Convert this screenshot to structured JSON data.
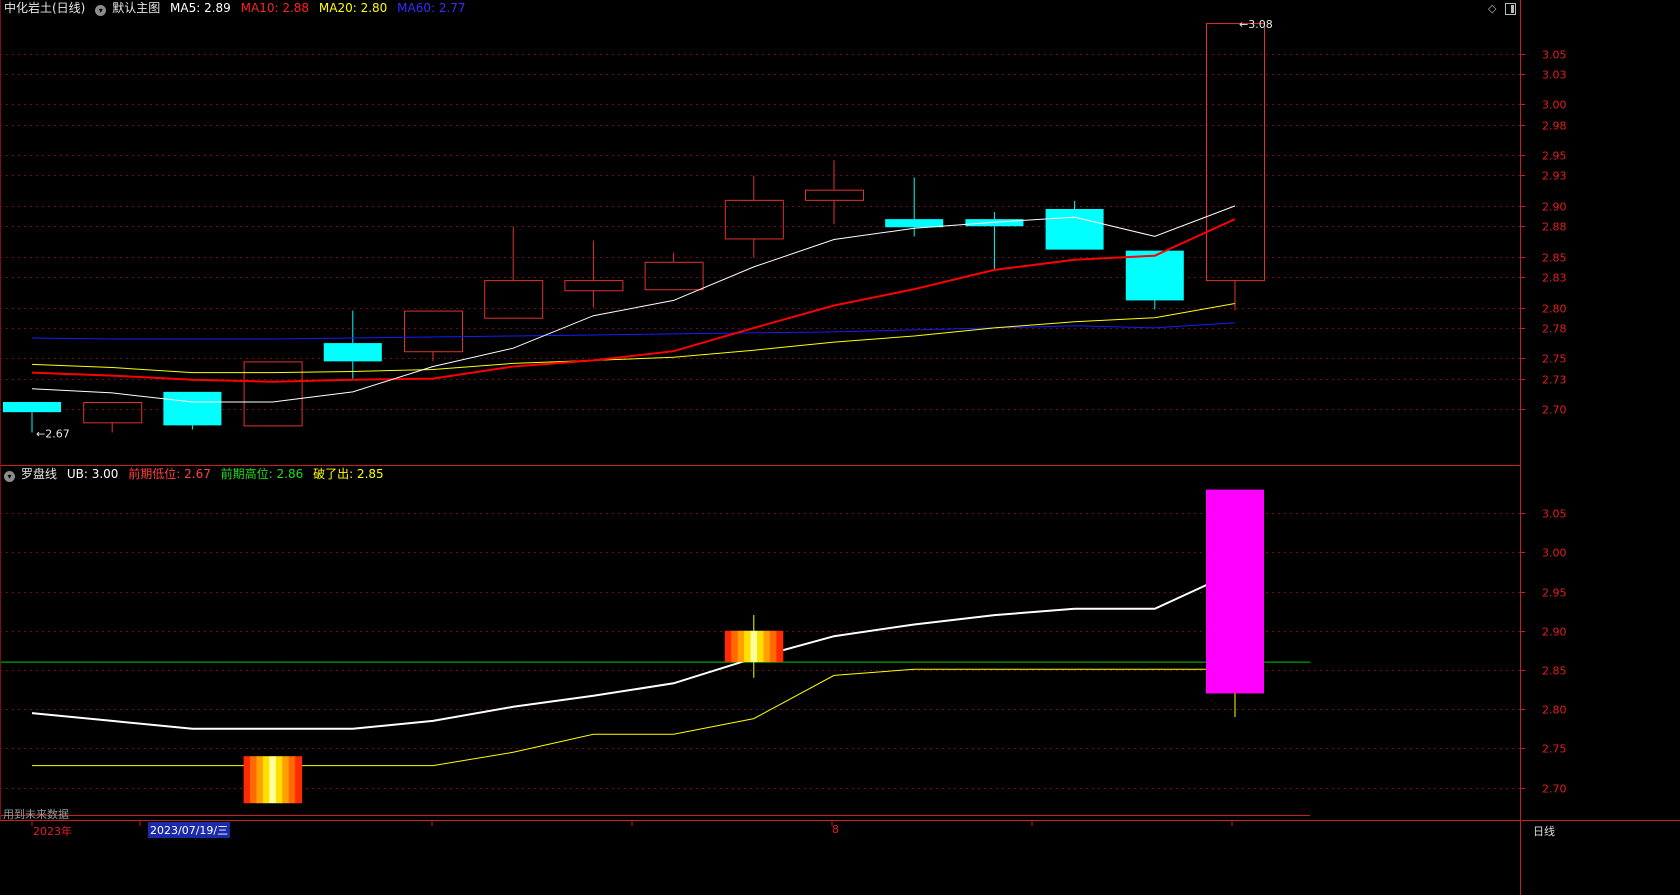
{
  "main_header": {
    "stock": "中化岩土(日线)",
    "template": "默认主图",
    "ma5_label": "MA5: 2.89",
    "ma10_label": "MA10: 2.88",
    "ma20_label": "MA20: 2.80",
    "ma60_label": "MA60: 2.77"
  },
  "sub_header": {
    "indicator": "罗盘线",
    "ub": "UB: 3.00",
    "prev_low": "前期低位: 2.67",
    "prev_high": "前期高位: 2.86",
    "break_out": "破了出: 2.85"
  },
  "footer": {
    "future_data": "用到未来数据",
    "year": "2023年",
    "cursor_date": "2023/07/19/三",
    "month_mark": "8",
    "period": "日线"
  },
  "colors": {
    "up": "#e0322e",
    "down": "#00ffff",
    "ma5": "#ffffff",
    "ma10": "#ff0000",
    "ma20": "#ffff00",
    "ma60": "#1a1aff",
    "axis": "#c81e1e",
    "signal_bar": "#ff00ff",
    "level_line": "#00cc00"
  },
  "chart_data": [
    {
      "type": "candlestick",
      "title": "中化岩土(日线)",
      "yticks": [
        2.7,
        2.73,
        2.75,
        2.78,
        2.8,
        2.83,
        2.85,
        2.88,
        2.9,
        2.93,
        2.95,
        2.98,
        3.0,
        3.03,
        3.05
      ],
      "ylim": [
        2.645,
        3.085
      ],
      "annotations": [
        {
          "label": "2.67",
          "x": 0
        },
        {
          "label": "3.08",
          "x": 15
        }
      ],
      "candles": [
        {
          "o": 2.707,
          "h": 2.707,
          "l": 2.677,
          "c": 2.697
        },
        {
          "o": 2.687,
          "h": 2.707,
          "l": 2.677,
          "c": 2.707
        },
        {
          "o": 2.717,
          "h": 2.717,
          "l": 2.68,
          "c": 2.684
        },
        {
          "o": 2.684,
          "h": 2.747,
          "l": 2.684,
          "c": 2.747
        },
        {
          "o": 2.765,
          "h": 2.797,
          "l": 2.73,
          "c": 2.747
        },
        {
          "o": 2.757,
          "h": 2.797,
          "l": 2.747,
          "c": 2.797
        },
        {
          "o": 2.79,
          "h": 2.88,
          "l": 2.79,
          "c": 2.827
        },
        {
          "o": 2.817,
          "h": 2.866,
          "l": 2.8,
          "c": 2.827
        },
        {
          "o": 2.818,
          "h": 2.854,
          "l": 2.818,
          "c": 2.845
        },
        {
          "o": 2.868,
          "h": 2.93,
          "l": 2.849,
          "c": 2.906
        },
        {
          "o": 2.906,
          "h": 2.945,
          "l": 2.882,
          "c": 2.916
        },
        {
          "o": 2.887,
          "h": 2.928,
          "l": 2.87,
          "c": 2.879
        },
        {
          "o": 2.887,
          "h": 2.894,
          "l": 2.838,
          "c": 2.88
        },
        {
          "o": 2.897,
          "h": 2.905,
          "l": 2.857,
          "c": 2.857
        },
        {
          "o": 2.856,
          "h": 2.856,
          "l": 2.798,
          "c": 2.807
        },
        {
          "o": 2.827,
          "h": 3.08,
          "l": 2.797,
          "c": 3.08
        }
      ],
      "ma5": [
        2.72,
        2.716,
        2.707,
        2.707,
        2.717,
        2.742,
        2.76,
        2.792,
        2.807,
        2.84,
        2.867,
        2.878,
        2.884,
        2.889,
        2.87,
        2.9
      ],
      "ma10": [
        2.736,
        2.733,
        2.729,
        2.727,
        2.729,
        2.73,
        2.742,
        2.748,
        2.757,
        2.78,
        2.802,
        2.818,
        2.837,
        2.847,
        2.851,
        2.887
      ],
      "ma20": [
        2.744,
        2.741,
        2.736,
        2.736,
        2.737,
        2.739,
        2.745,
        2.748,
        2.751,
        2.758,
        2.766,
        2.772,
        2.78,
        2.786,
        2.79,
        2.804
      ],
      "ma60": [
        2.77,
        2.769,
        2.769,
        2.769,
        2.77,
        2.771,
        2.772,
        2.773,
        2.774,
        2.775,
        2.776,
        2.778,
        2.78,
        2.782,
        2.78,
        2.785
      ]
    },
    {
      "type": "line",
      "title": "罗盘线",
      "yticks": [
        2.7,
        2.75,
        2.8,
        2.85,
        2.9,
        2.95,
        3.0,
        3.05
      ],
      "ylim": [
        2.665,
        3.105
      ],
      "ub": [
        2.795,
        2.785,
        2.775,
        2.775,
        2.775,
        2.785,
        2.803,
        2.817,
        2.833,
        2.865,
        2.893,
        2.908,
        2.92,
        2.928,
        2.928,
        2.975
      ],
      "break_out": [
        2.728,
        2.728,
        2.728,
        2.728,
        2.728,
        2.728,
        2.745,
        2.768,
        2.768,
        2.788,
        2.843,
        2.851,
        2.851,
        2.851,
        2.851,
        2.851
      ],
      "prev_high_level": 2.86,
      "prev_low_marker": {
        "x": 3,
        "low": 2.68,
        "high": 2.74
      },
      "prev_high_marker": {
        "x": 9,
        "low": 2.86,
        "high": 2.9,
        "wick_low": 2.84,
        "wick_high": 2.92
      },
      "signal_bar": {
        "x": 15,
        "low": 2.82,
        "high": 3.08,
        "wick_low": 2.79
      }
    }
  ]
}
